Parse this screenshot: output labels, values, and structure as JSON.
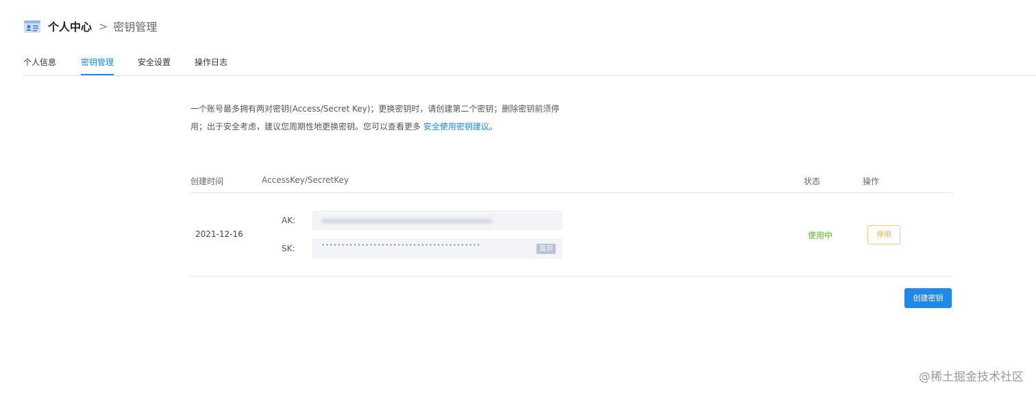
{
  "header": {
    "icon": "profile-card-icon",
    "root": "个人中心",
    "separator": ">",
    "current": "密钥管理"
  },
  "tabs": [
    {
      "label": "个人信息",
      "active": false
    },
    {
      "label": "密钥管理",
      "active": true
    },
    {
      "label": "安全设置",
      "active": false
    },
    {
      "label": "操作日志",
      "active": false
    }
  ],
  "notice": {
    "text_line1": "一个账号最多拥有两对密钥(Access/Secret Key)；更换密钥时，请创建第二个密钥；删除密钥前须停",
    "text_line2": "用；出于安全考虑，建议您周期性地更换密钥。您可以查看更多 ",
    "link": "安全使用密钥建议",
    "suffix": "。"
  },
  "table": {
    "columns": [
      "创建时间",
      "AccessKey/SecretKey",
      "状态",
      "操作"
    ],
    "rows": [
      {
        "created": "2021-12-16",
        "ak_label": "AK:",
        "sk_label": "SK:",
        "sk_mask": "••••••••••••••••••••••••••••••••••••••••",
        "show_label": "显示",
        "status": "使用中",
        "action_label": "停用"
      }
    ]
  },
  "create_button": "创建密钥",
  "watermark": "@稀土掘金技术社区",
  "colors": {
    "accent": "#1f88ea",
    "status_active": "#52c41a",
    "warning": "#f5b042"
  }
}
